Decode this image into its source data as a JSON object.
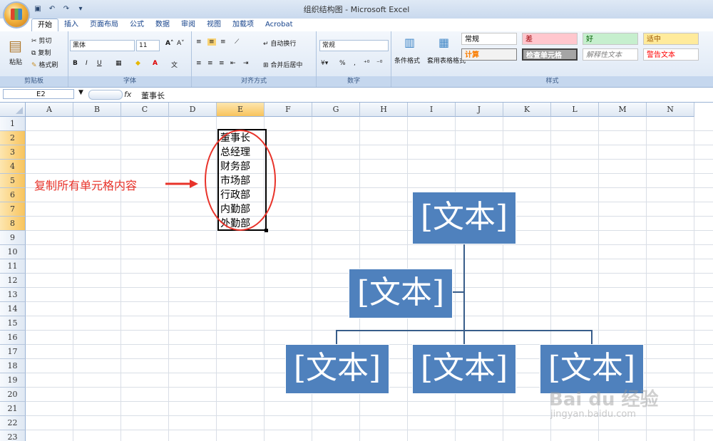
{
  "window": {
    "title": "组织结构图 - Microsoft Excel"
  },
  "tabs": [
    "开始",
    "插入",
    "页面布局",
    "公式",
    "数据",
    "审阅",
    "视图",
    "加载项",
    "Acrobat"
  ],
  "ribbon": {
    "clipboard": {
      "paste": "粘贴",
      "cut": "剪切",
      "copy": "复制",
      "format_painter": "格式刷",
      "label": "剪贴板"
    },
    "font": {
      "name": "黑体",
      "size": "11",
      "bold": "B",
      "italic": "I",
      "underline": "U",
      "label": "字体"
    },
    "alignment": {
      "wrap": "自动换行",
      "merge": "合并后居中",
      "label": "对齐方式"
    },
    "number": {
      "format": "常规",
      "percent": "%",
      "comma": ",",
      "label": "数字"
    },
    "styles": {
      "conditional": "条件格式",
      "table_format": "套用表格格式",
      "label": "样式",
      "cells": [
        {
          "text": "常规",
          "color": "#000000",
          "bg": "#ffffff"
        },
        {
          "text": "差",
          "color": "#9c0006",
          "bg": "#ffc7ce"
        },
        {
          "text": "好",
          "color": "#006100",
          "bg": "#c6efce"
        },
        {
          "text": "适中",
          "color": "#9c5700",
          "bg": "#ffeb9c"
        },
        {
          "text": "计算",
          "color": "#fa7d00",
          "bg": "#f2f2f2"
        },
        {
          "text": "检查单元格",
          "color": "#ffffff",
          "bg": "#a5a5a5"
        },
        {
          "text": "解释性文本",
          "color": "#7f7f7f",
          "bg": "#ffffff"
        },
        {
          "text": "警告文本",
          "color": "#ff0000",
          "bg": "#ffffff"
        }
      ]
    }
  },
  "formula_bar": {
    "name_box": "E2",
    "fx": "fx",
    "content": "董事长"
  },
  "columns": [
    "A",
    "B",
    "C",
    "D",
    "E",
    "F",
    "G",
    "H",
    "I",
    "J",
    "K",
    "L",
    "M",
    "N"
  ],
  "rows": [
    "1",
    "2",
    "3",
    "4",
    "5",
    "6",
    "7",
    "8",
    "9",
    "10",
    "11",
    "12",
    "13",
    "14",
    "15",
    "16",
    "17",
    "18",
    "19",
    "20",
    "21",
    "22",
    "23"
  ],
  "cells_E": [
    "董事长",
    "总经理",
    "财务部",
    "市场部",
    "行政部",
    "内勤部",
    "外勤部"
  ],
  "annotation": {
    "text": "复制所有单元格内容"
  },
  "smartart": {
    "placeholder": "[文本]"
  },
  "watermark": {
    "brand": "Bai du 经验",
    "url": "jingyan.baidu.com"
  }
}
